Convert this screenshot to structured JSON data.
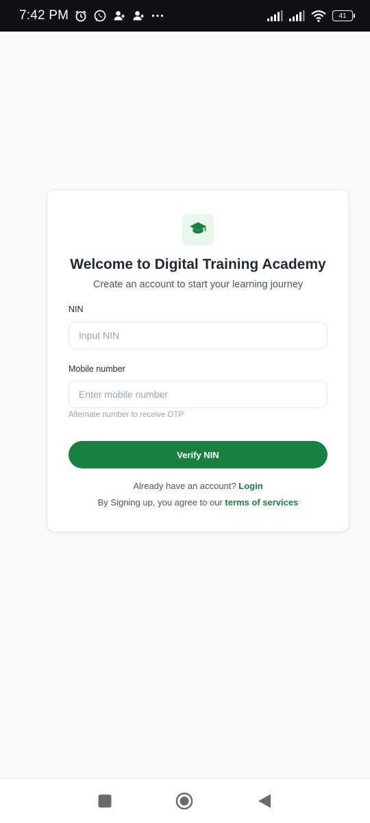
{
  "status_bar": {
    "time": "7:42 PM",
    "left_icons": [
      "alarm-icon",
      "whatsapp-icon",
      "person-add-icon",
      "person-add-icon",
      "more-icon"
    ],
    "right_icons": [
      "signal-icon",
      "signal-icon",
      "wifi-icon",
      "battery-icon"
    ],
    "battery_level": "41"
  },
  "card": {
    "logo_icon": "graduation-cap-icon",
    "title": "Welcome to Digital Training Academy",
    "subtitle": "Create an account to start your learning journey",
    "nin": {
      "label": "NIN",
      "placeholder": "Input NIN",
      "value": ""
    },
    "mobile": {
      "label": "Mobile number",
      "placeholder": "Enter mobile number",
      "value": "",
      "hint": "Alternate number to receive OTP"
    },
    "verify_button": "Verify NIN",
    "login_prompt": "Already have an account?",
    "login_link": "Login",
    "terms_prompt": "By Signing up, you agree to our",
    "terms_link": "terms of services"
  },
  "colors": {
    "accent": "#1a8041",
    "logo_bg": "#e9f6ec",
    "page_bg": "#f8f9fb",
    "status_bar_bg": "#0f1115"
  },
  "nav_bar": {
    "buttons": [
      "recents-square-icon",
      "home-circle-icon",
      "back-triangle-icon"
    ]
  }
}
